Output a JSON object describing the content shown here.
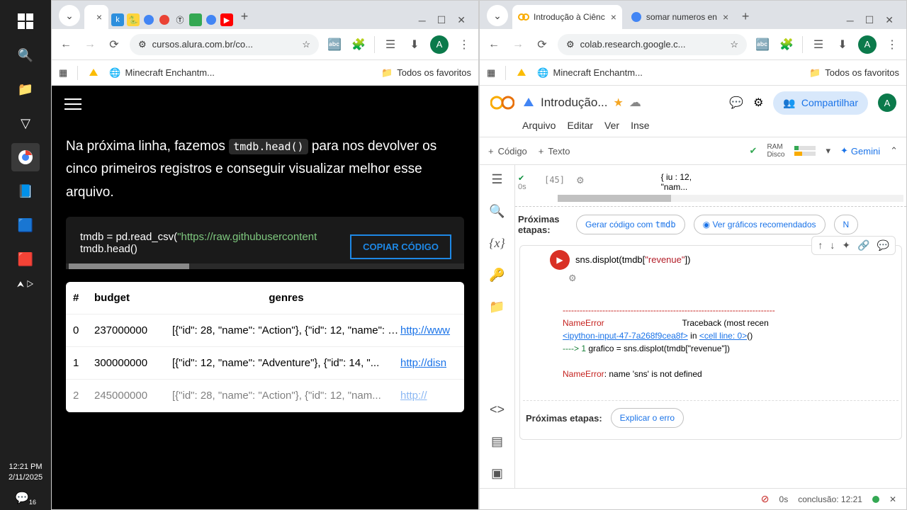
{
  "taskbar": {
    "time": "12:21 PM",
    "date": "2/11/2025",
    "notif_count": "16"
  },
  "win1": {
    "tabs": {
      "active_title": "",
      "bg_icons": [
        "k",
        "p",
        "G",
        "c",
        "T",
        "s",
        "G",
        "y"
      ]
    },
    "url": "cursos.alura.com.br/co...",
    "bookmark1": "Minecraft Enchantm...",
    "bookmark_all": "Todos os favoritos",
    "article": {
      "para_pre": "Na próxima linha, fazemos ",
      "code_inline": "tmdb.head()",
      "para_post": " para nos devolver os cinco primeiros registros e conseguir visualizar melhor esse arquivo.",
      "code_line1_pre": "tmdb = pd.read_csv(",
      "code_line1_str": "\"https://raw.githubusercontent",
      "code_line2": "tmdb.head()",
      "copy_label": "COPIAR CÓDIGO"
    },
    "table": {
      "headers": [
        "#",
        "budget",
        "genres",
        ""
      ],
      "rows": [
        {
          "idx": "0",
          "budget": "237000000",
          "genres": "[{\"id\": 28, \"name\": \"Action\"}, {\"id\": 12, \"name\": \"A...",
          "link": "http://www"
        },
        {
          "idx": "1",
          "budget": "300000000",
          "genres": "[{\"id\": 12, \"name\": \"Adventure\"}, {\"id\": 14, \"...",
          "link": "http://disn"
        },
        {
          "idx": "2",
          "budget": "245000000",
          "genres": "[{\"id\": 28, \"name\": \"Action\"}, {\"id\": 12, \"nam...",
          "link": "http://"
        }
      ]
    }
  },
  "win2": {
    "tabs": {
      "t1": "Introdução à Ciênc",
      "t2": "somar numeros en"
    },
    "url": "colab.research.google.c...",
    "bookmark1": "Minecraft Enchantm...",
    "bookmark_all": "Todos os favoritos",
    "docname": "Introdução...",
    "share": "Compartilhar",
    "menus": [
      "Arquivo",
      "Editar",
      "Ver",
      "Inse"
    ],
    "insert_code": "Código",
    "insert_text": "Texto",
    "ram": "RAM",
    "disk": "Disco",
    "gemini": "Gemini",
    "cell1": {
      "exec": "[45]",
      "time": "0s",
      "out1": "{ iu : 12,",
      "out2": "\"nam..."
    },
    "nextsteps_label": "Próximas etapas:",
    "chip1_pre": "Gerar código com ",
    "chip1_mono": "tmdb",
    "chip2": "Ver gráficos recomendados",
    "chip3": "N",
    "cell2": {
      "code_pre": "sns.displot(tmdb[",
      "code_str": "\"revenue\"",
      "code_post": "])",
      "err_dash": "---------------------------------------------------------------------------",
      "err_name": "NameError",
      "err_trace": "                                 Traceback (most recen",
      "err_link": "<ipython-input-47-7a268f9cea8f>",
      "err_in": " in ",
      "err_cell": "<cell line: 0>",
      "err_paren": "()",
      "err_arrow": "----> ",
      "err_one": "1",
      "err_linecode": " grafico = sns.displot(tmdb[\"revenue\"])",
      "err_final_name": "NameError",
      "err_final_msg": ": name 'sns' is not defined"
    },
    "explain": "Explicar o erro",
    "status_time": "0s",
    "status_comp": "conclusão: 12:21"
  }
}
